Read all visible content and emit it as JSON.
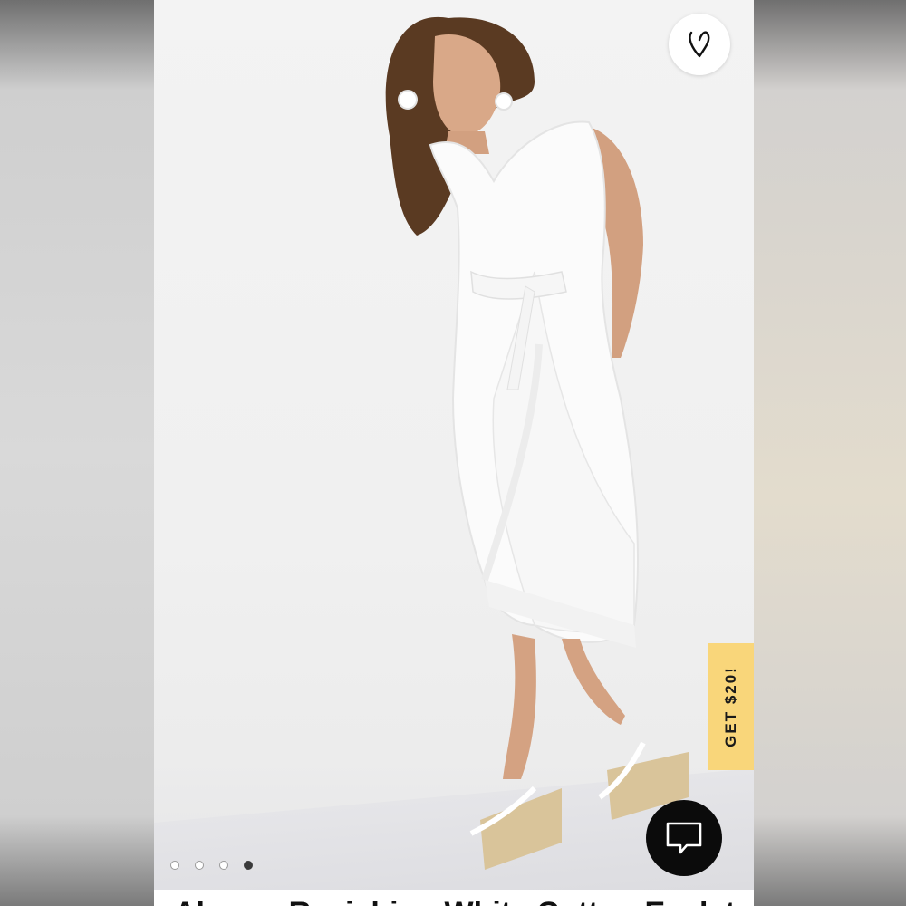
{
  "product": {
    "title": "Always Ravishing White Cotton Eyelet",
    "gallery": {
      "total_images": 4,
      "active_index": 3
    }
  },
  "wishlist": {
    "icon": "heart-icon"
  },
  "promo": {
    "label": "GET $20!",
    "color": "#f9d67a"
  },
  "chat": {
    "icon": "chat-bubble-icon",
    "color": "#0b0b0b"
  }
}
